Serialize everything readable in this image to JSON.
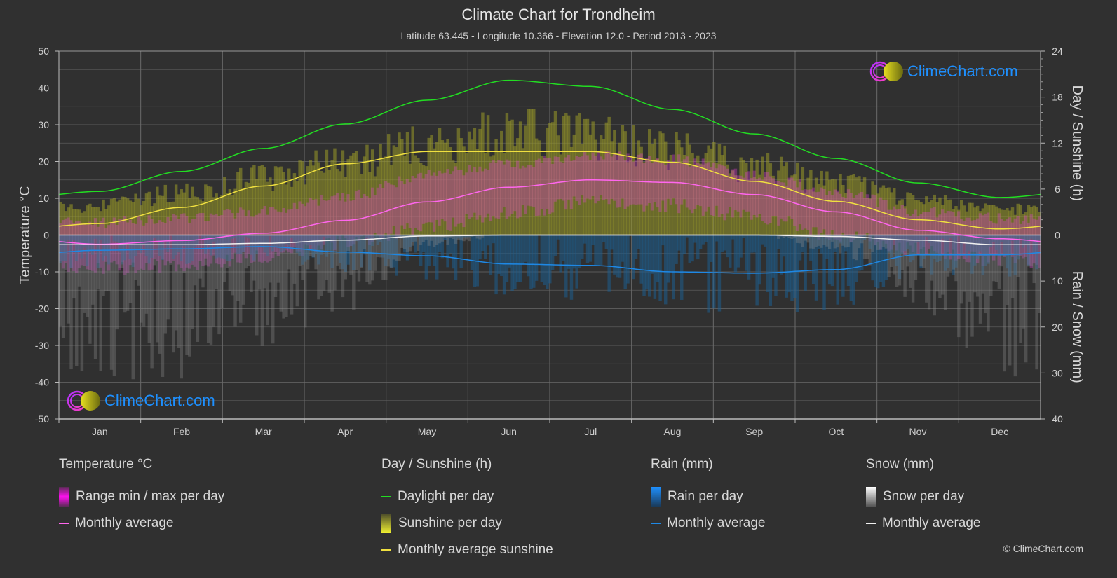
{
  "header": {
    "title": "Climate Chart for Trondheim",
    "subtitle": "Latitude 63.445 - Longitude 10.366 - Elevation 12.0 - Period 2013 - 2023"
  },
  "logo": {
    "text": "ClimeChart.com"
  },
  "copyright": "© ClimeChart.com",
  "legend": {
    "temperature": {
      "title": "Temperature °C",
      "range_label": "Range min / max per day",
      "avg_label": "Monthly average"
    },
    "sunshine": {
      "title": "Day / Sunshine (h)",
      "daylight_label": "Daylight per day",
      "sunshine_label": "Sunshine per day",
      "avg_label": "Monthly average sunshine"
    },
    "rain": {
      "title": "Rain (mm)",
      "per_day_label": "Rain per day",
      "avg_label": "Monthly average"
    },
    "snow": {
      "title": "Snow (mm)",
      "per_day_label": "Snow per day",
      "avg_label": "Monthly average"
    }
  },
  "colors": {
    "background": "#303030",
    "grid": "#5a5a5a",
    "daylight": "#22dd22",
    "sunshine_avg": "#f0e040",
    "sunshine_fill": "#9a9a28",
    "temp_avg": "#ff66ee",
    "temp_range": "#e040d0",
    "rain_avg": "#1e88e5",
    "rain_fill": "#1e5f8f",
    "snow_avg": "#f0f0f0",
    "snow_fill": "#8a8a8a"
  },
  "chart_data": {
    "type": "line",
    "title": "Climate Chart for Trondheim",
    "categories": [
      "Jan",
      "Feb",
      "Mar",
      "Apr",
      "May",
      "Jun",
      "Jul",
      "Aug",
      "Sep",
      "Oct",
      "Nov",
      "Dec"
    ],
    "left_axis": {
      "label": "Temperature °C",
      "range": [
        -50,
        50
      ],
      "ticks": [
        50,
        40,
        30,
        20,
        10,
        0,
        -10,
        -20,
        -30,
        -40,
        -50
      ]
    },
    "right_axis_top": {
      "label": "Day / Sunshine (h)",
      "range": [
        0,
        24
      ],
      "ticks": [
        24,
        18,
        12,
        6,
        0
      ]
    },
    "right_axis_bottom": {
      "label": "Rain / Snow (mm)",
      "range": [
        0,
        40
      ],
      "ticks": [
        0,
        10,
        20,
        30,
        40
      ]
    },
    "grid": true,
    "legend_position": "bottom",
    "series": [
      {
        "name": "Daylight per day",
        "axis": "hours",
        "values": [
          5.7,
          8.3,
          11.3,
          14.5,
          17.6,
          20.2,
          19.4,
          16.4,
          13.2,
          10.0,
          6.8,
          4.9
        ]
      },
      {
        "name": "Monthly average sunshine",
        "axis": "hours",
        "values": [
          1.5,
          3.6,
          6.4,
          9.3,
          10.9,
          10.9,
          10.9,
          9.5,
          7.0,
          4.4,
          2.0,
          0.8
        ]
      },
      {
        "name": "Temperature monthly average",
        "axis": "temperature",
        "values": [
          -2.5,
          -1.5,
          0.5,
          4.0,
          9.0,
          13.0,
          15.0,
          14.3,
          11.0,
          6.3,
          1.3,
          -1.0
        ]
      },
      {
        "name": "Rain monthly average",
        "axis": "precip",
        "values": [
          3.3,
          3.0,
          2.5,
          3.7,
          4.5,
          6.3,
          6.6,
          8.0,
          8.3,
          7.5,
          4.3,
          4.3
        ]
      },
      {
        "name": "Snow monthly average",
        "axis": "precip",
        "values": [
          2.1,
          2.1,
          1.8,
          1.1,
          0.2,
          0.0,
          0.0,
          0.0,
          0.0,
          0.3,
          1.1,
          2.1
        ]
      }
    ],
    "temp_range_approx": {
      "min": [
        -7,
        -6,
        -4,
        0,
        4,
        8,
        11,
        10,
        7,
        2,
        -2,
        -5
      ],
      "max": [
        2,
        3,
        5,
        9,
        15,
        18,
        20,
        19,
        15,
        10,
        5,
        3
      ]
    }
  }
}
